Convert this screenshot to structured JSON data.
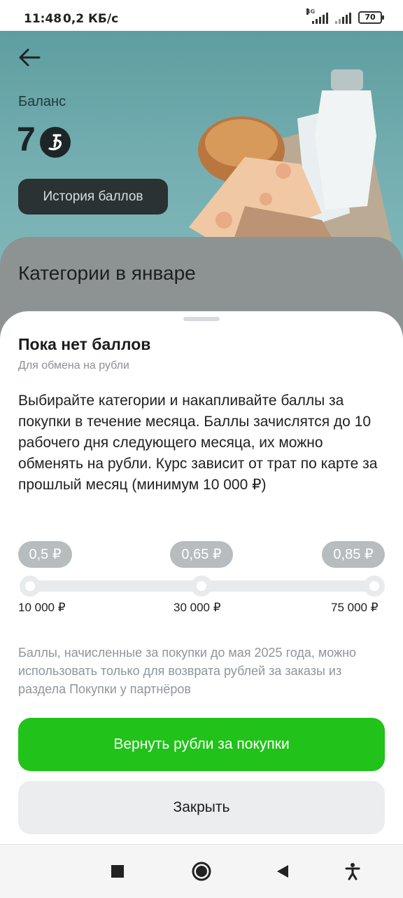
{
  "status_bar": {
    "time": "11:48",
    "speed": "0,2 КБ/с",
    "network_tag": "4G",
    "battery": "70"
  },
  "hero": {
    "balance_label": "Баланс",
    "balance_value": "7",
    "history_button": "История баллов",
    "background_color": "#74aeb1"
  },
  "categories": {
    "title": "Категории в январе"
  },
  "sheet": {
    "title": "Пока нет баллов",
    "subtitle": "Для обмена на рубли",
    "description": "Выбирайте категории и накапливайте баллы за покупки в течение месяца. Баллы зачислятся до 10 рабочего дня следующего месяца, их можно обменять на рубли. Курс зависит от трат по карте за прошлый месяц (минимум 10 000 ₽)",
    "rates": [
      {
        "rate": "0,5 ₽",
        "threshold": "10 000 ₽"
      },
      {
        "rate": "0,65 ₽",
        "threshold": "30 000 ₽"
      },
      {
        "rate": "0,85 ₽",
        "threshold": "75 000 ₽"
      }
    ],
    "note": "Баллы, начисленные за покупки до мая 2025 года, можно использовать только для возврата рублей за заказы из раздела Покупки у партнёров",
    "primary_button": "Вернуть рубли за покупки",
    "secondary_button": "Закрыть",
    "accent_color": "#21c21a"
  },
  "nav": {
    "icons": [
      "square-stop-icon",
      "circle-home-icon",
      "triangle-back-icon",
      "accessibility-icon"
    ]
  }
}
